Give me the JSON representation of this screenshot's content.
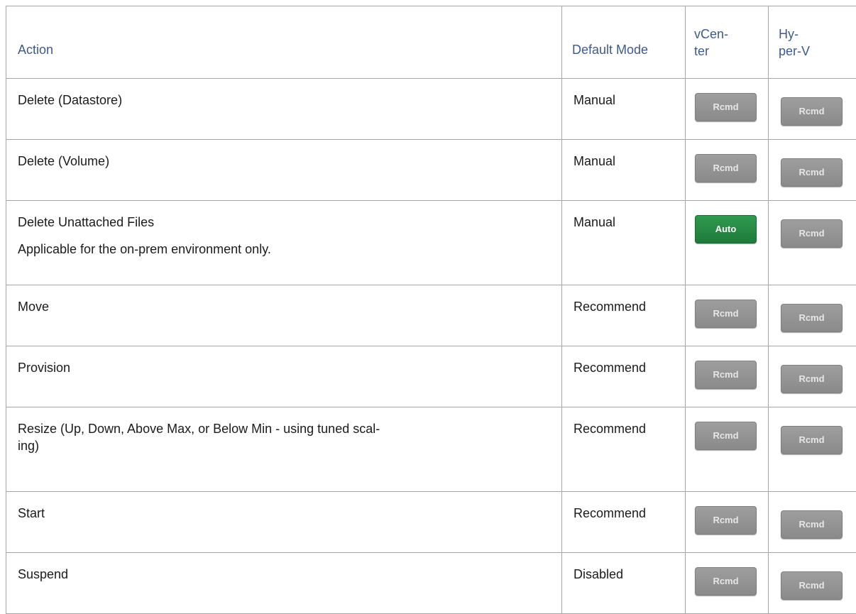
{
  "headers": {
    "action": "Action",
    "default_mode": "Default Mode",
    "vcenter": "vCen-\nter",
    "hyperv": "Hy-\nper-V"
  },
  "rows": [
    {
      "action": "Delete (Datastore)",
      "note": "",
      "mode": "Manual",
      "vcenter": "Rcmd",
      "hyperv": "Rcmd"
    },
    {
      "action": "Delete (Volume)",
      "note": "",
      "mode": "Manual",
      "vcenter": "Rcmd",
      "hyperv": "Rcmd"
    },
    {
      "action": "Delete Unattached Files",
      "note": "Applicable for the on-prem environment only.",
      "mode": "Manual",
      "vcenter": "Auto",
      "hyperv": "Rcmd"
    },
    {
      "action": "Move",
      "note": "",
      "mode": "Recommend",
      "vcenter": "Rcmd",
      "hyperv": "Rcmd"
    },
    {
      "action": "Provision",
      "note": "",
      "mode": "Recommend",
      "vcenter": "Rcmd",
      "hyperv": "Rcmd"
    },
    {
      "action": "Resize (Up, Down, Above Max, or Below Min - using tuned scal-\ning)",
      "note": "",
      "mode": "Recommend",
      "vcenter": "Rcmd",
      "hyperv": "Rcmd"
    },
    {
      "action": "Start",
      "note": "",
      "mode": "Recommend",
      "vcenter": "Rcmd",
      "hyperv": "Rcmd"
    },
    {
      "action": "Suspend",
      "note": "",
      "mode": "Disabled",
      "vcenter": "Rcmd",
      "hyperv": "Rcmd"
    }
  ],
  "colors": {
    "header_text": "#3f5a8a",
    "rcmd_badge": "#8f8f8f",
    "auto_badge": "#23843f",
    "border": "#a6a6a6"
  }
}
